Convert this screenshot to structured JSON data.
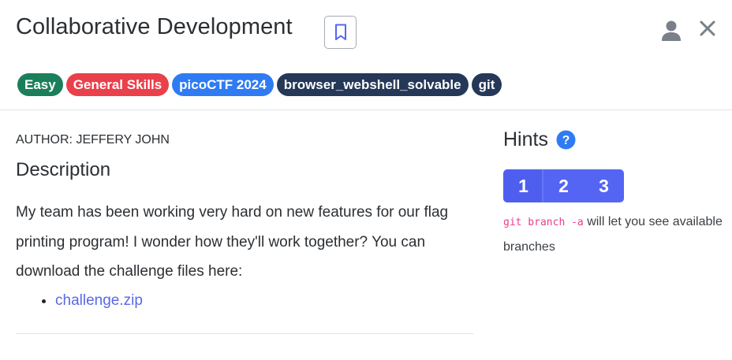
{
  "header": {
    "title": "Collaborative Development",
    "icons": {
      "bookmark": "bookmark-icon",
      "user": "user-icon",
      "close": "close-icon"
    }
  },
  "tags": [
    {
      "label": "Easy",
      "color": "#1a7f5a"
    },
    {
      "label": "General Skills",
      "color": "#e9404b"
    },
    {
      "label": "picoCTF 2024",
      "color": "#2f7bf3"
    },
    {
      "label": "browser_webshell_solvable",
      "color": "#253858"
    },
    {
      "label": "git",
      "color": "#253858"
    }
  ],
  "challenge": {
    "author": "AUTHOR: JEFFERY JOHN",
    "description_heading": "Description",
    "description": "My team has been working very hard on new features for our flag printing program! I wonder how they'll work together? You can download the challenge files here:",
    "files": [
      "challenge.zip"
    ]
  },
  "hints": {
    "heading": "Hints",
    "help_icon": "question-circle-icon",
    "tabs": [
      "1",
      "2",
      "3"
    ],
    "active_tab": "1",
    "hint_code": "git branch -a",
    "hint_text": " will let you see available branches"
  },
  "colors": {
    "accent": "#5465f4",
    "link": "#5869e6",
    "help": "#2f7bf3"
  }
}
